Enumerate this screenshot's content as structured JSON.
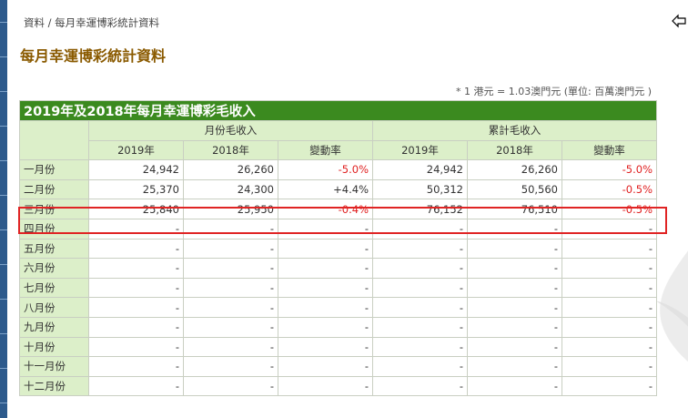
{
  "breadcrumb": "資料 / 每月幸運博彩統計資料",
  "page_title": "每月幸運博彩統計資料",
  "note": "* 1 港元 = 1.03澳門元 (單位: 百萬澳門元 )",
  "table": {
    "title": "2019年及2018年每月幸運博彩毛收入",
    "group_monthly": "月份毛收入",
    "group_cumulative": "累計毛收入",
    "col_2019": "2019年",
    "col_2018": "2018年",
    "col_change": "變動率",
    "rows": [
      {
        "month": "一月份",
        "m2019": "24,942",
        "m2018": "26,260",
        "mchg": "-5.0%",
        "c2019": "24,942",
        "c2018": "26,260",
        "cchg": "-5.0%"
      },
      {
        "month": "二月份",
        "m2019": "25,370",
        "m2018": "24,300",
        "mchg": "+4.4%",
        "c2019": "50,312",
        "c2018": "50,560",
        "cchg": "-0.5%"
      },
      {
        "month": "三月份",
        "m2019": "25,840",
        "m2018": "25,950",
        "mchg": "-0.4%",
        "c2019": "76,152",
        "c2018": "76,510",
        "cchg": "-0.5%"
      },
      {
        "month": "四月份",
        "m2019": "-",
        "m2018": "-",
        "mchg": "-",
        "c2019": "-",
        "c2018": "-",
        "cchg": "-"
      },
      {
        "month": "五月份",
        "m2019": "-",
        "m2018": "-",
        "mchg": "-",
        "c2019": "-",
        "c2018": "-",
        "cchg": "-"
      },
      {
        "month": "六月份",
        "m2019": "-",
        "m2018": "-",
        "mchg": "-",
        "c2019": "-",
        "c2018": "-",
        "cchg": "-"
      },
      {
        "month": "七月份",
        "m2019": "-",
        "m2018": "-",
        "mchg": "-",
        "c2019": "-",
        "c2018": "-",
        "cchg": "-"
      },
      {
        "month": "八月份",
        "m2019": "-",
        "m2018": "-",
        "mchg": "-",
        "c2019": "-",
        "c2018": "-",
        "cchg": "-"
      },
      {
        "month": "九月份",
        "m2019": "-",
        "m2018": "-",
        "mchg": "-",
        "c2019": "-",
        "c2018": "-",
        "cchg": "-"
      },
      {
        "month": "十月份",
        "m2019": "-",
        "m2018": "-",
        "mchg": "-",
        "c2019": "-",
        "c2018": "-",
        "cchg": "-"
      },
      {
        "month": "十一月份",
        "m2019": "-",
        "m2018": "-",
        "mchg": "-",
        "c2019": "-",
        "c2018": "-",
        "cchg": "-"
      },
      {
        "month": "十二月份",
        "m2019": "-",
        "m2018": "-",
        "mchg": "-",
        "c2019": "-",
        "c2018": "-",
        "cchg": "-"
      }
    ]
  },
  "colors": {
    "header_green": "#3b8a1f",
    "light_green": "#dcefc9",
    "title_brown": "#8a5a00",
    "negative_red": "#e02020",
    "highlight_red": "#e02424",
    "left_strip_blue": "#2d5a8c"
  },
  "icons": {
    "back": "back-arrow-icon"
  }
}
